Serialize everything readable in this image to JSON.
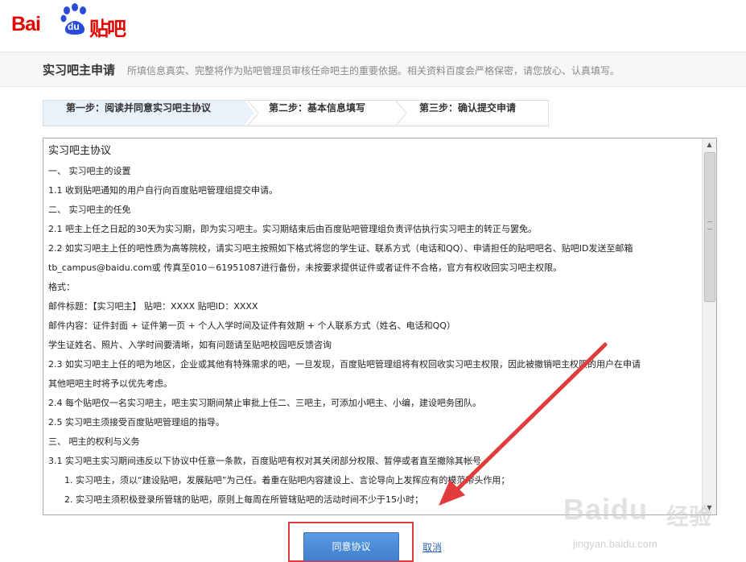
{
  "logo": {
    "left": "Bai",
    "mid": "du",
    "right": "贴吧"
  },
  "header": {
    "title": "实习吧主申请",
    "subtitle": "所填信息真实、完整将作为贴吧管理员审核任命吧主的重要依据。相关资料百度会严格保密，请您放心、认真填写。"
  },
  "steps": [
    {
      "label": "第一步：阅读并同意实习吧主协议",
      "active": true
    },
    {
      "label": "第二步：基本信息填写",
      "active": false
    },
    {
      "label": "第三步：确认提交申请",
      "active": false
    }
  ],
  "agreement": {
    "title": "实习吧主协议",
    "lines": [
      "一、 实习吧主的设置",
      "1.1 收到贴吧通知的用户自行向百度贴吧管理组提交申请。",
      "二、 实习吧主的任免",
      "2.1 吧主上任之日起的30天为实习期，即为实习吧主。实习期结束后由百度贴吧管理组负责评估执行实习吧主的转正与罢免。",
      "2.2 如实习吧主上任的吧性质为高等院校，请实习吧主按照如下格式将您的学生证、联系方式（电话和QQ）、申请担任的贴吧吧名、贴吧ID发送至邮箱",
      "tb_campus@baidu.com或 传真至010－61951087进行备份，未按要求提供证件或者证件不合格，官方有权收回实习吧主权限。",
      "格式：",
      "邮件标题：【实习吧主】 贴吧：XXXX 贴吧ID：XXXX",
      "邮件内容：证件封面 + 证件第一页 + 个人入学时间及证件有效期 + 个人联系方式（姓名、电话和QQ）",
      "学生证姓名、照片、入学时间要清晰，如有问题请至贴吧校园吧反馈咨询",
      "2.3 如实习吧主上任的吧为地区，企业或其他有特殊需求的吧，一旦发现，百度贴吧管理组将有权回收实习吧主权限，因此被撤销吧主权限的用户在申请",
      "其他吧吧主时将予以优先考虑。",
      "2.4 每个贴吧仅一名实习吧主，吧主实习期间禁止审批上任二、三吧主，可添加小吧主、小编，建设吧务团队。",
      "2.5 实习吧主须接受百度贴吧管理组的指导。",
      "三、 吧主的权利与义务",
      "3.1 实习吧主实习期间违反以下协议中任意一条款，百度贴吧有权对其关闭部分权限、暂停或者直至撤除其帐号。"
    ],
    "indented_lines": [
      "1. 实习吧主，须以“建设贴吧，发展贴吧”为己任。着重在贴吧内容建设上、言论导向上发挥应有的模范带头作用；",
      "2. 实习吧主须积极登录所管辖的贴吧，原则上每周在所管辖贴吧的活动时间不少于15小时；"
    ]
  },
  "buttons": {
    "agree": "同意协议",
    "cancel": "取消"
  },
  "watermark": {
    "brand": "Baidu",
    "product": "经验",
    "url": "jingyan.baidu.com"
  },
  "colors": {
    "brand_red": "#e10602",
    "button_blue": "#4a8bd8",
    "link_blue": "#2d64b3",
    "annotation_red": "#e23b3b"
  }
}
